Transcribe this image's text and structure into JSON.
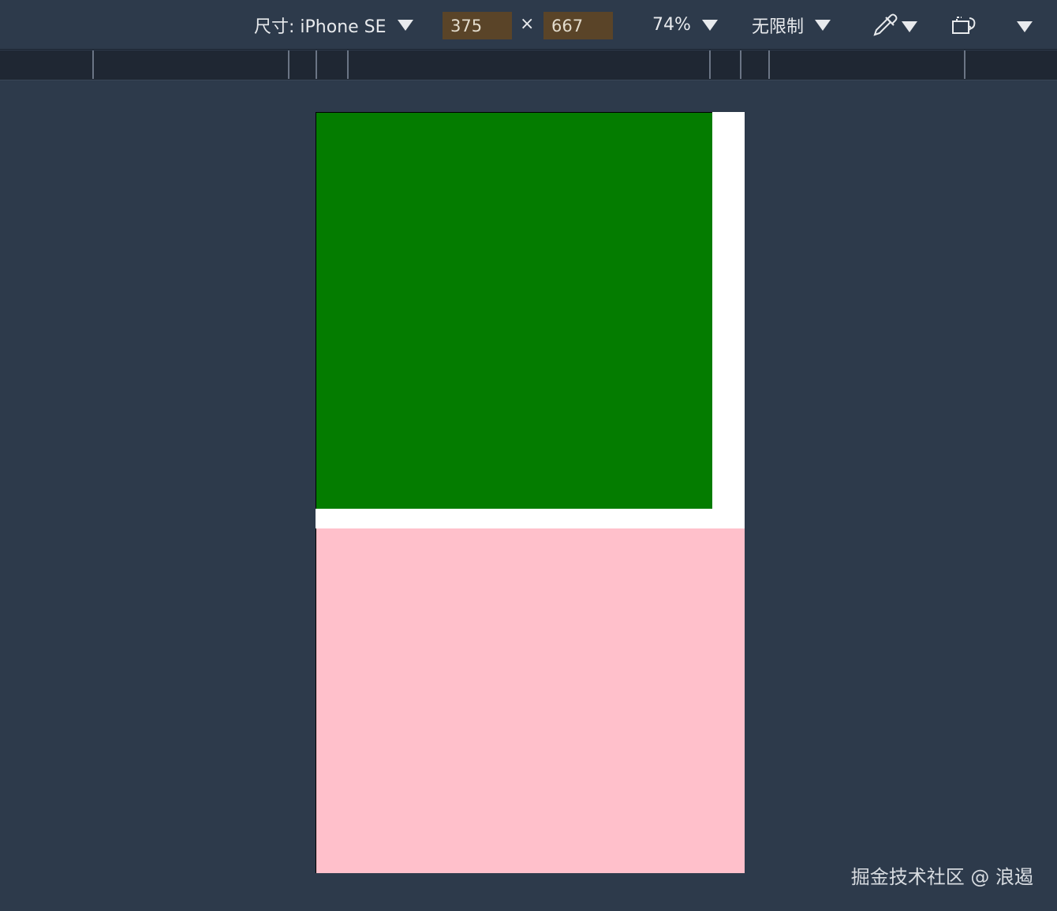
{
  "toolbar": {
    "dimensions_label": "尺寸: iPhone SE",
    "width_value": "375",
    "times_symbol": "×",
    "height_value": "667",
    "zoom_label": "74%",
    "throttle_label": "无限制",
    "eyedropper_icon": "eyedropper-icon",
    "rotate_icon": "rotate-icon"
  },
  "viewport": {
    "green_color": "#047c00",
    "pink_color": "#ffc0cb"
  },
  "watermark": "掘金技术社区 @ 浪遏"
}
